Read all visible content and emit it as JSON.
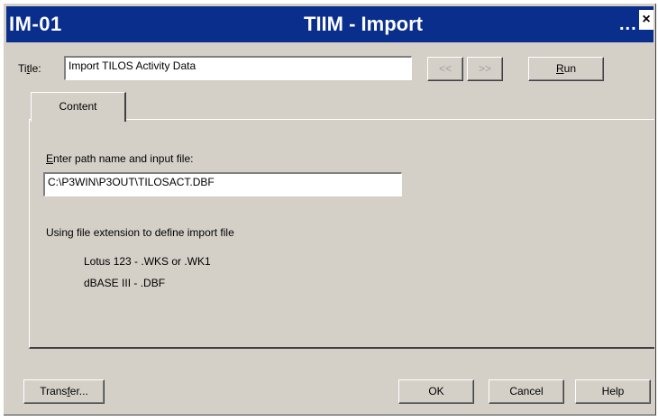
{
  "window": {
    "code": "IM-01",
    "title": "TIIM - Import",
    "more": "...",
    "close": "×"
  },
  "title_row": {
    "label_prefix": "Ti",
    "label_mnemonic": "t",
    "label_suffix": "le:",
    "value": "Import TILOS Activity Data",
    "prev_label": "<<",
    "next_label": ">>",
    "run_mnemonic": "R",
    "run_rest": "un"
  },
  "tabs": [
    {
      "label": "Content",
      "selected": true
    }
  ],
  "content": {
    "path_mnemonic": "E",
    "path_label_rest": "nter path name and input file:",
    "path_value": "C:\\P3WIN\\P3OUT\\TILOSACT.DBF",
    "info_text": "Using file extension to define import file",
    "formats": [
      "Lotus  123 - .WKS or .WK1",
      "dBASE III  - .DBF"
    ]
  },
  "footer": {
    "transfer_prefix": "Trans",
    "transfer_mnemonic": "f",
    "transfer_suffix": "er...",
    "ok_label": "OK",
    "cancel_label": "Cancel",
    "help_label": "Help"
  }
}
